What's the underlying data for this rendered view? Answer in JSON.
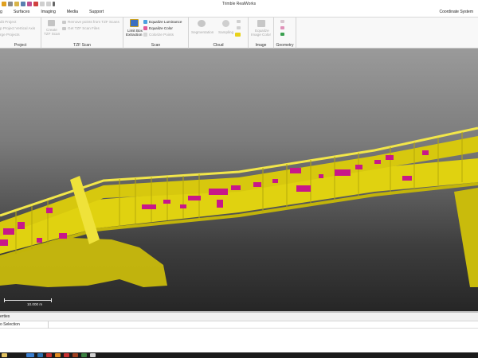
{
  "app": {
    "title": "Trimble RealWorks"
  },
  "menu": {
    "tabs": [
      "g",
      "Surfaces",
      "Imaging",
      "Media",
      "Support"
    ],
    "right_label": "Coordinate System"
  },
  "ribbon": {
    "project": {
      "items": [
        "dit Project",
        "p Project Vertical Axis",
        "rge Projects"
      ],
      "label": "Project"
    },
    "tzf_scan": {
      "create_line1": "Create",
      "create_line2": "TZF Scan",
      "remove": "Remove points from TZF Scans",
      "get": "Get TZF Scan Files",
      "label": "TZF Scan"
    },
    "scan": {
      "limit_line1": "Limit Box",
      "limit_line2": "Extraction",
      "equalize_luminance": "Equalize Luminance",
      "equalize_color": "Equalize Color",
      "colorize_points": "Colorize Points",
      "label": "Scan"
    },
    "cloud": {
      "segmentation": "Segmentation",
      "sampling": "Sampling",
      "label": "Cloud"
    },
    "image": {
      "equalize_line1": "Equalize",
      "equalize_line2": "Image Color",
      "label": "Image"
    },
    "geometry": {
      "label": "Geometry"
    }
  },
  "viewport": {
    "scale_label": "10.000 m",
    "colors": {
      "cloud": "#e0d210",
      "cloud_light": "#f2e64a",
      "highlight": "#c8178a"
    }
  },
  "properties": {
    "title": "erties",
    "column_1": "o Selection"
  }
}
